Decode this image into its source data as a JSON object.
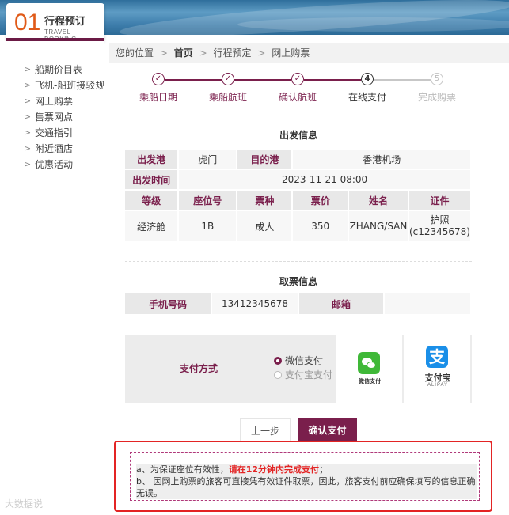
{
  "logo": {
    "number": "01",
    "title_cn": "行程预订",
    "title_en": "TRAVEL BOOKING"
  },
  "sidebar": {
    "items": [
      {
        "label": "船期价目表"
      },
      {
        "label": "飞机-船班接驳规"
      },
      {
        "label": "网上购票"
      },
      {
        "label": "售票网点"
      },
      {
        "label": "交通指引"
      },
      {
        "label": "附近酒店"
      },
      {
        "label": "优惠活动"
      }
    ]
  },
  "breadcrumb": {
    "prefix": "您的位置",
    "home": "首页",
    "level2": "行程预定",
    "level3": "网上购票",
    "separator": ">"
  },
  "steps": [
    {
      "label": "乘船日期",
      "mark": "✓",
      "state": "done"
    },
    {
      "label": "乘船航班",
      "mark": "✓",
      "state": "done"
    },
    {
      "label": "确认航班",
      "mark": "✓",
      "state": "done"
    },
    {
      "label": "在线支付",
      "mark": "4",
      "state": "current"
    },
    {
      "label": "完成购票",
      "mark": "5",
      "state": "todo"
    }
  ],
  "departure": {
    "title": "出发信息",
    "port_label": "出发港",
    "port_value": "虎门",
    "dest_label": "目的港",
    "dest_value": "香港机场",
    "time_label": "出发时间",
    "time_value": "2023-11-21 08:00",
    "columns": [
      "等级",
      "座位号",
      "票种",
      "票价",
      "姓名",
      "证件"
    ],
    "row": [
      "经济舱",
      "1B",
      "成人",
      "350",
      "ZHANG/SAN",
      "护照",
      "(c12345678)"
    ]
  },
  "pickup": {
    "title": "取票信息",
    "phone_label": "手机号码",
    "phone_value": "13412345678",
    "email_label": "邮箱",
    "email_value": ""
  },
  "payment": {
    "label": "支付方式",
    "options": [
      {
        "label": "微信支付",
        "selected": true
      },
      {
        "label": "支付宝支付",
        "selected": false
      }
    ],
    "wechat_caption": "微信支付",
    "alipay_glyph": "支",
    "alipay_caption": "支付宝",
    "alipay_sub": "ALIPAY"
  },
  "buttons": {
    "prev": "上一步",
    "confirm": "确认支付"
  },
  "notice": {
    "line_a_prefix": "a、为保证座位有效性，",
    "line_a_red": "请在12分钟内完成支付",
    "line_a_suffix": "；",
    "line_b": "b、  因网上购票的旅客可直接凭有效证件取票，因此，旅客支付前应确保填写的信息正确无误。"
  },
  "watermark": "大数据说",
  "colors": {
    "brand": "#7a1f4c",
    "alert": "#e32424",
    "logo_orange": "#e05a18"
  }
}
